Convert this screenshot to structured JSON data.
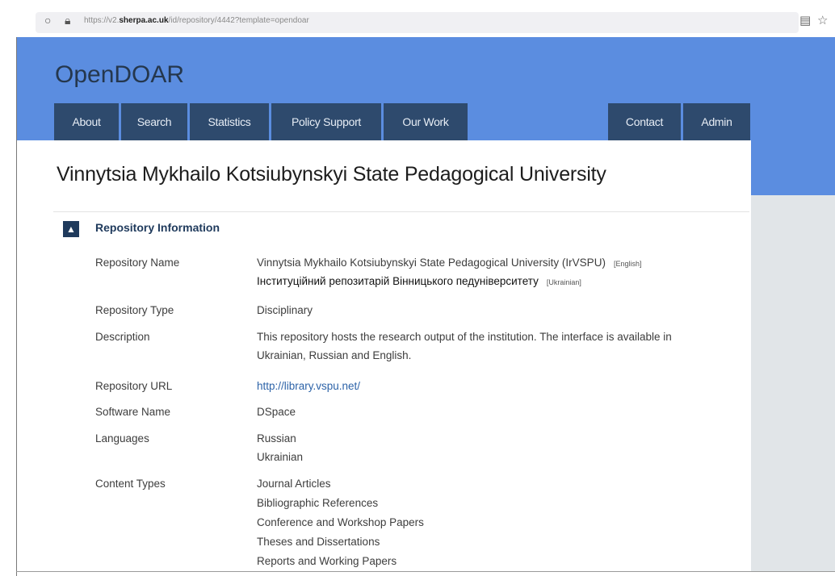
{
  "browser": {
    "url_prefix": "https://v2.",
    "url_domain": "sherpa.ac.uk",
    "url_path": "/id/repository/4442?template=opendoar"
  },
  "site": {
    "logo": "OpenDOAR",
    "nav": [
      "About",
      "Search",
      "Statistics",
      "Policy Support",
      "Our Work",
      "Contact",
      "Admin"
    ]
  },
  "page": {
    "title": "Vinnytsia Mykhailo Kotsiubynskyi State Pedagogical University",
    "section_title": "Repository Information"
  },
  "labels": {
    "repo_name": "Repository Name",
    "repo_type": "Repository Type",
    "description": "Description",
    "repo_url": "Repository URL",
    "software": "Software Name",
    "languages": "Languages",
    "content_types": "Content Types"
  },
  "values": {
    "name_en": "Vinnytsia Mykhailo Kotsiubynskyi State Pedagogical University (IrVSPU)",
    "name_en_tag": "[English]",
    "name_uk": "Інституційний репозитарій Вінницького педуніверситету",
    "name_uk_tag": "[Ukrainian]",
    "type": "Disciplinary",
    "description_line1": "This repository hosts the research output of the institution. The interface is available in",
    "description_line2": "Ukrainian, Russian and English.",
    "url": "http://library.vspu.net/",
    "software": "DSpace",
    "languages": [
      "Russian",
      "Ukrainian"
    ],
    "content_types": [
      "Journal Articles",
      "Bibliographic References",
      "Conference and Workshop Papers",
      "Theses and Dissertations",
      "Reports and Working Papers"
    ]
  },
  "icons": {
    "browser": [
      "page-icon",
      "lock-icon",
      "reader-view-icon",
      "bookmark-star-icon"
    ],
    "section": "chevron-up-icon"
  },
  "colors": {
    "header": "#5b8de0",
    "nav": "#2e4a6d",
    "accent": "#1f3a5c",
    "link": "#2d63a8"
  }
}
